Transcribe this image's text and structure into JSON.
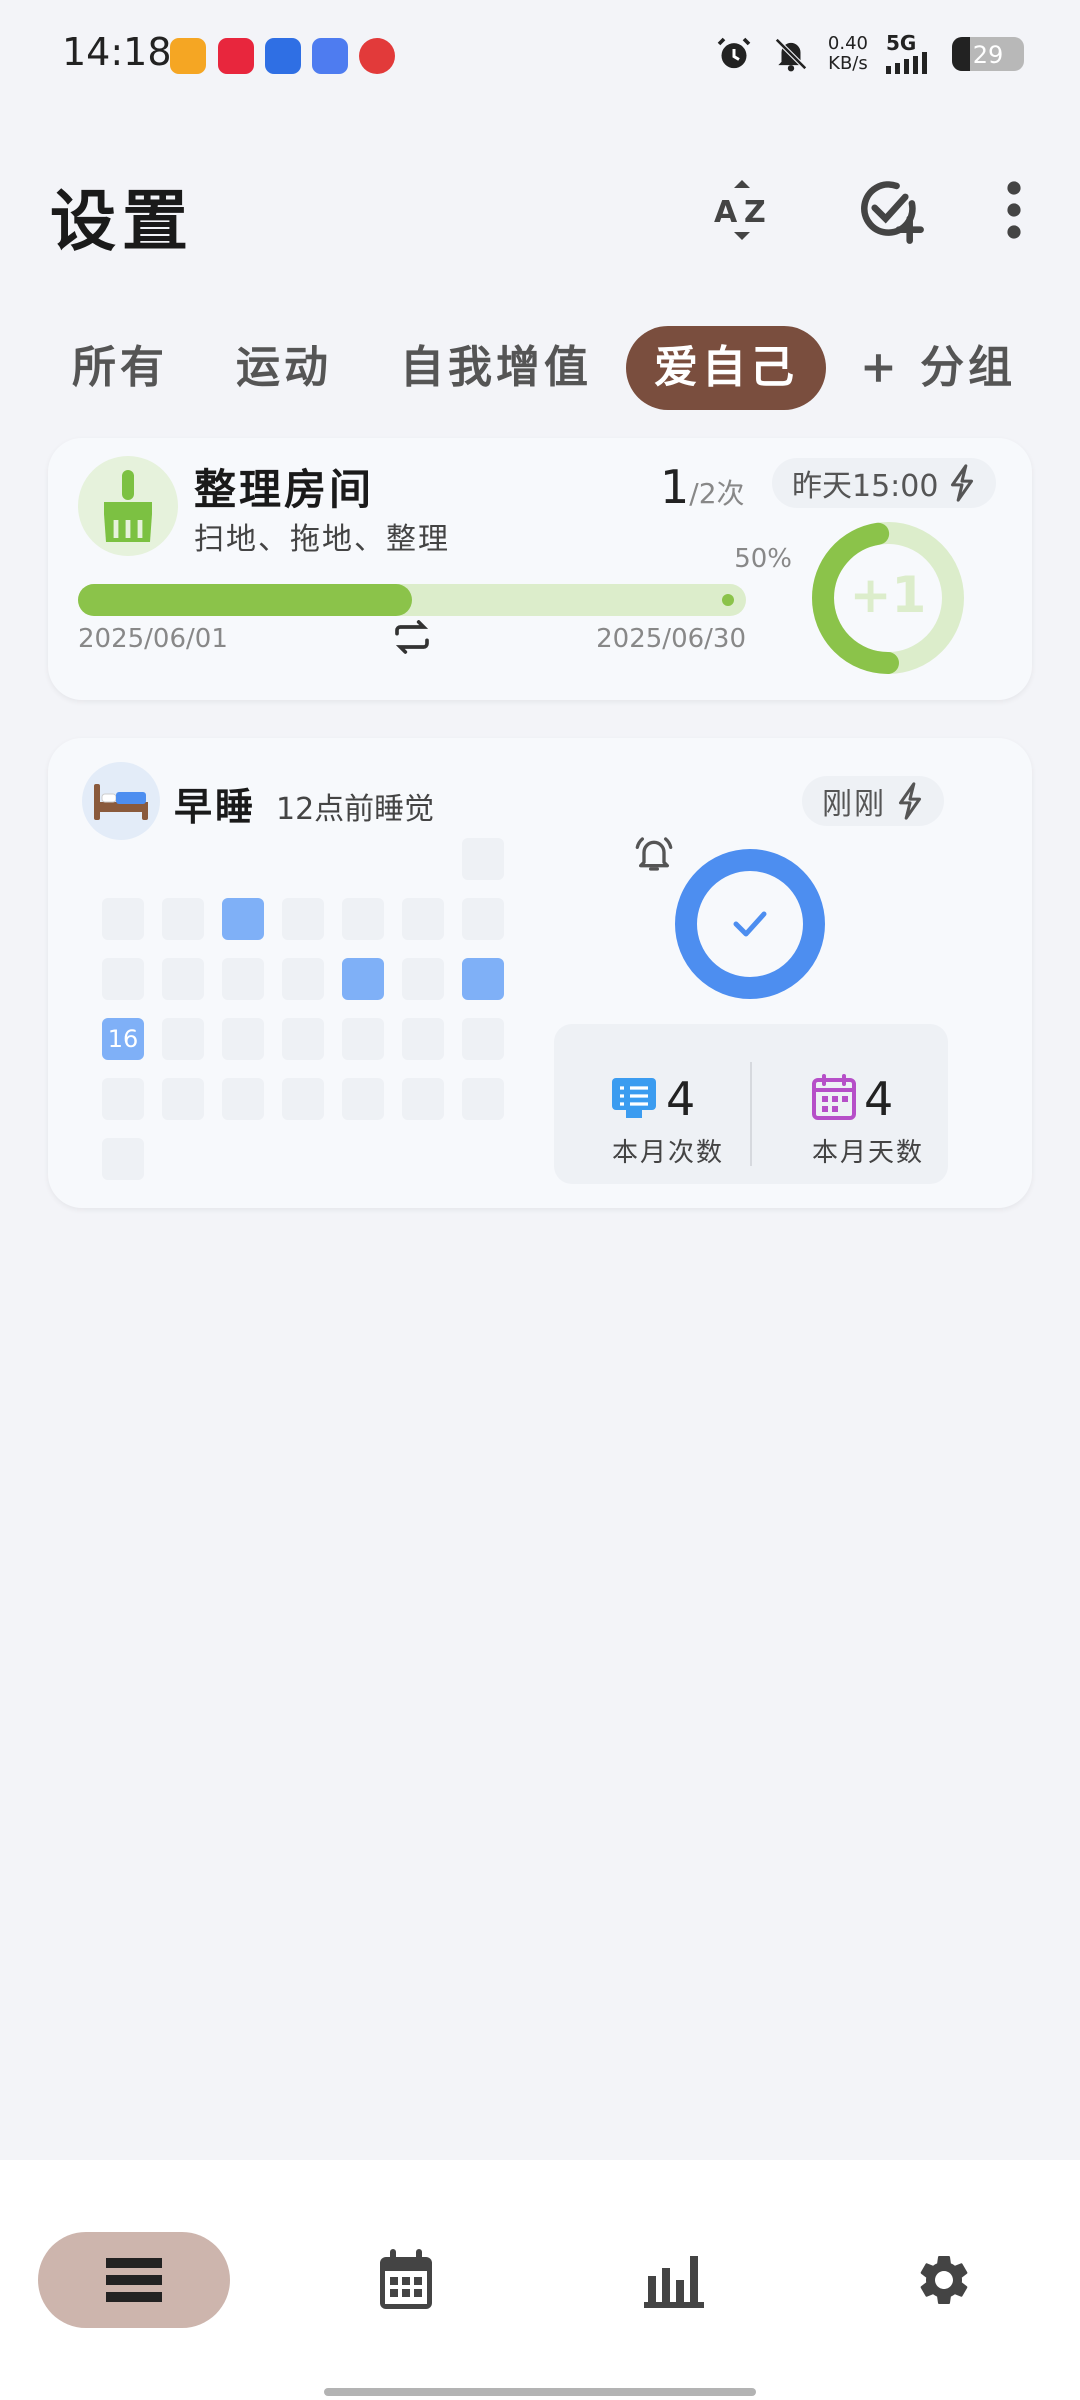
{
  "status_bar": {
    "time": "14:18",
    "net_speed_value": "0.40",
    "net_speed_unit": "KB/s",
    "network": "5G",
    "battery": "29"
  },
  "header": {
    "title": "设置",
    "sort_icon": "sort-az-icon",
    "add_icon": "add-habit-icon",
    "more_icon": "more-vert-icon"
  },
  "tabs": [
    {
      "label": "所有",
      "active": false
    },
    {
      "label": "运动",
      "active": false
    },
    {
      "label": "自我增值",
      "active": false
    },
    {
      "label": "爱自己",
      "active": true
    },
    {
      "label": "+ 分组",
      "active": false
    }
  ],
  "habit1": {
    "name": "整理房间",
    "desc": "扫地、拖地、整理",
    "count": "1",
    "goal": "/2次",
    "percent_label": "50%",
    "progress": 0.5,
    "start_date": "2025/06/01",
    "end_date": "2025/06/30",
    "last_time": "昨天15:00",
    "plus_label": "+1",
    "accent": "#8bc34a"
  },
  "habit2": {
    "name": "早睡",
    "desc": "12点前睡觉",
    "last_time": "刚刚",
    "today": "16",
    "times_value": "4",
    "times_label": "本月次数",
    "days_value": "4",
    "days_label": "本月天数",
    "accent": "#4d8ef0"
  },
  "nav": [
    {
      "icon": "list-icon",
      "active": true
    },
    {
      "icon": "calendar-icon",
      "active": false
    },
    {
      "icon": "stats-icon",
      "active": false
    },
    {
      "icon": "settings-gear-icon",
      "active": false
    }
  ]
}
